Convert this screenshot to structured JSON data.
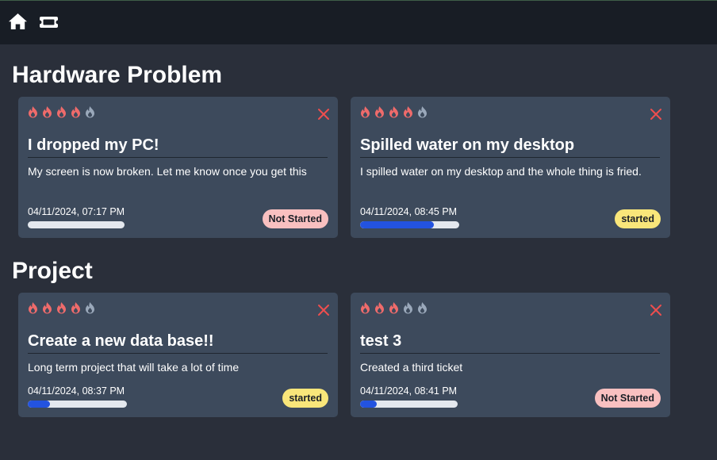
{
  "nav": {
    "home_icon": "home-icon",
    "tickets_icon": "ticket-icon"
  },
  "colors": {
    "flame_active": "#ef6b6b",
    "flame_inactive": "#9aa8ba",
    "close": "#ef4e4e",
    "progress_fill": "#2353e0",
    "badge_not_started": "#f9c0c0",
    "badge_started": "#f9e67a"
  },
  "sections": [
    {
      "title": "Hardware Problem",
      "tickets": [
        {
          "priority": 4,
          "title": "I dropped my PC!",
          "description": "My screen is now broken. Let me know once you get this",
          "date": "04/11/2024, 07:17 PM",
          "progress": 0,
          "status": "Not Started"
        },
        {
          "priority": 4,
          "title": "Spilled water on my desktop",
          "description": "I spilled water on my desktop and the whole thing is fried.",
          "date": "04/11/2024, 08:45 PM",
          "progress": 0.74,
          "status": "started"
        }
      ]
    },
    {
      "title": "Project",
      "tickets": [
        {
          "priority": 4,
          "title": "Create a new data base!!",
          "description": "Long term project that will take a lot of time",
          "date": "04/11/2024, 08:37 PM",
          "progress": 0.22,
          "status": "started"
        },
        {
          "priority": 3,
          "title": "test 3",
          "description": "Created  a third ticket",
          "date": "04/11/2024, 08:41 PM",
          "progress": 0.17,
          "status": "Not Started"
        }
      ]
    }
  ]
}
